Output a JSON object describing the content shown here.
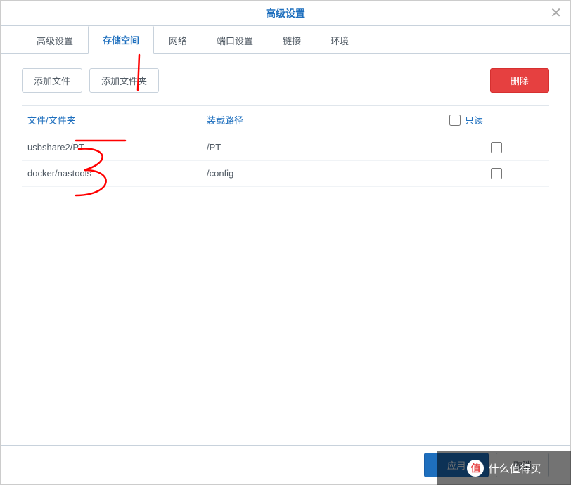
{
  "header": {
    "title": "高级设置"
  },
  "tabs": [
    {
      "label": "高级设置",
      "active": false
    },
    {
      "label": "存储空间",
      "active": true
    },
    {
      "label": "网络",
      "active": false
    },
    {
      "label": "端口设置",
      "active": false
    },
    {
      "label": "链接",
      "active": false
    },
    {
      "label": "环境",
      "active": false
    }
  ],
  "toolbar": {
    "add_file_label": "添加文件",
    "add_folder_label": "添加文件夹",
    "delete_label": "删除"
  },
  "table": {
    "headers": {
      "file": "文件/文件夹",
      "mount": "装载路径",
      "readonly": "只读"
    },
    "rows": [
      {
        "file": "usbshare2/PT",
        "mount": "/PT",
        "readonly": false
      },
      {
        "file": "docker/nastools",
        "mount": "/config",
        "readonly": false
      }
    ]
  },
  "footer": {
    "apply_label": "应用",
    "cancel_label": "取消"
  },
  "watermark": {
    "badge": "值",
    "text": "什么值得买"
  }
}
